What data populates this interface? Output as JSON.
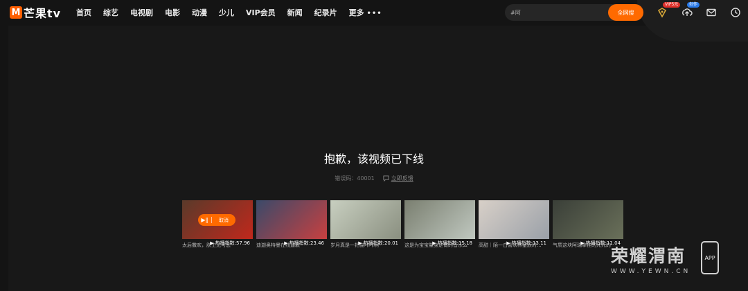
{
  "brand": {
    "logo_mark": "M",
    "logo_text": "芒果tv"
  },
  "nav": {
    "items": [
      "首页",
      "综艺",
      "电视剧",
      "电影",
      "动漫",
      "少儿",
      "VIP会员",
      "新闻",
      "纪录片"
    ],
    "more": "更多",
    "more_dots": "•••"
  },
  "search": {
    "value": "#阿",
    "button": "全网搜"
  },
  "header_icons": {
    "vip_badge": "VIP5元",
    "upload_badge": "创作",
    "icons": [
      "vip-diamond-icon",
      "upload-icon",
      "mail-icon",
      "history-clock-icon"
    ]
  },
  "message": {
    "title": "抱歉，该视频已下线",
    "error_code": "错误码：40001",
    "feedback": "立即反馈"
  },
  "recommendations": [
    {
      "heat": "热播指数:57.96",
      "caption": "太后撒欢，朕生无可恋",
      "colors": [
        "#5a3a2a",
        "#c0281c"
      ]
    },
    {
      "heat": "热播指数:23.46",
      "caption": "迪迦奥特曼在线逼歉",
      "colors": [
        "#3a4a6a",
        "#c84040"
      ]
    },
    {
      "heat": "热播指数:20.01",
      "caption": "岁月真是一把猫咔咔啊",
      "colors": [
        "#c8cfc0",
        "#8a8f80"
      ]
    },
    {
      "heat": "热播指数:15.18",
      "caption": "这是为宝宝量身定做的音乐么",
      "colors": [
        "#7a7f70",
        "#c0c8c0"
      ]
    },
    {
      "heat": "热播指数:13.11",
      "caption": "高甜｜陌一白喜欢林星辰时...",
      "colors": [
        "#d8d0c8",
        "#9aa0a8"
      ]
    },
    {
      "heat": "热播指数:11.04",
      "caption": "气质这块阿瑞拿捏的死死的",
      "colors": [
        "#3a3f38",
        "#6a705a"
      ]
    }
  ],
  "overlay": {
    "play": "▶‖",
    "cancel": "取消"
  },
  "watermark": {
    "title": "荣耀渭南",
    "sub": "WWW.YEWN.CN",
    "app": "APP"
  },
  "colors": {
    "accent": "#ff6a00",
    "bg": "#181818",
    "header": "#141414"
  }
}
